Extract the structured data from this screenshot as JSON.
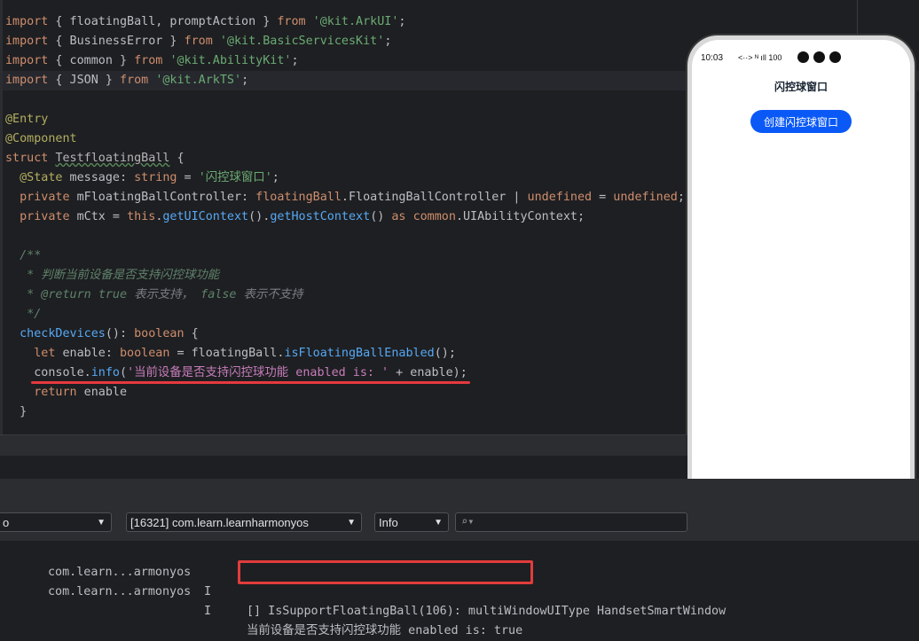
{
  "editor": {
    "lines": [
      [
        {
          "t": "import",
          "c": "kw"
        },
        {
          "t": " { floatingBall, promptAction } "
        },
        {
          "t": "from",
          "c": "kw"
        },
        {
          "t": " "
        },
        {
          "t": "'@kit.ArkUI'",
          "c": "str"
        },
        {
          "t": ";"
        }
      ],
      [
        {
          "t": "import",
          "c": "kw"
        },
        {
          "t": " { BusinessError } "
        },
        {
          "t": "from",
          "c": "kw"
        },
        {
          "t": " "
        },
        {
          "t": "'@kit.BasicServicesKit'",
          "c": "str"
        },
        {
          "t": ";"
        }
      ],
      [
        {
          "t": "import",
          "c": "kw"
        },
        {
          "t": " { common } "
        },
        {
          "t": "from",
          "c": "kw"
        },
        {
          "t": " "
        },
        {
          "t": "'@kit.AbilityKit'",
          "c": "str"
        },
        {
          "t": ";"
        }
      ],
      [
        {
          "t": "import",
          "c": "kw"
        },
        {
          "t": " { JSON } "
        },
        {
          "t": "from",
          "c": "kw"
        },
        {
          "t": " "
        },
        {
          "t": "'@kit.ArkTS'",
          "c": "str"
        },
        {
          "t": ";"
        }
      ],
      [],
      [
        {
          "t": "@Entry",
          "c": "ann"
        }
      ],
      [
        {
          "t": "@Component",
          "c": "ann"
        }
      ],
      [
        {
          "t": "struct",
          "c": "kw"
        },
        {
          "t": " "
        },
        {
          "t": "TestfloatingBall",
          "c": "cls"
        },
        {
          "t": " {"
        }
      ],
      [
        {
          "t": "  "
        },
        {
          "t": "@State",
          "c": "ann"
        },
        {
          "t": " message: "
        },
        {
          "t": "string",
          "c": "kw"
        },
        {
          "t": " = "
        },
        {
          "t": "'闪控球窗口'",
          "c": "str"
        },
        {
          "t": ";"
        }
      ],
      [
        {
          "t": "  "
        },
        {
          "t": "private",
          "c": "kw"
        },
        {
          "t": " mFloatingBallController: "
        },
        {
          "t": "floatingBall",
          "c": "kw"
        },
        {
          "t": ".FloatingBallController | "
        },
        {
          "t": "undefined",
          "c": "kw"
        },
        {
          "t": " = "
        },
        {
          "t": "undefined",
          "c": "kw"
        },
        {
          "t": ";"
        }
      ],
      [
        {
          "t": "  "
        },
        {
          "t": "private",
          "c": "kw"
        },
        {
          "t": " mCtx = "
        },
        {
          "t": "this",
          "c": "kw"
        },
        {
          "t": "."
        },
        {
          "t": "getUIContext",
          "c": "fn"
        },
        {
          "t": "()."
        },
        {
          "t": "getHostContext",
          "c": "fn"
        },
        {
          "t": "() "
        },
        {
          "t": "as",
          "c": "kw"
        },
        {
          "t": " "
        },
        {
          "t": "common",
          "c": "kw"
        },
        {
          "t": ".UIAbilityContext;"
        }
      ],
      [],
      [
        {
          "t": "  /**",
          "c": "cmt"
        }
      ],
      [
        {
          "t": "   * 判断当前设备是否支持闪控球功能",
          "c": "cmt"
        }
      ],
      [
        {
          "t": "   * @return ",
          "c": "cmt"
        },
        {
          "t": "true",
          "c": "cmt"
        },
        {
          "t": " 表示支持， ",
          "c": "cm"
        },
        {
          "t": "false",
          "c": "cmt"
        },
        {
          "t": " 表示不支持",
          "c": "cm"
        }
      ],
      [
        {
          "t": "   */",
          "c": "cmt"
        }
      ],
      [
        {
          "t": "  "
        },
        {
          "t": "checkDevices",
          "c": "fn"
        },
        {
          "t": "(): "
        },
        {
          "t": "boolean",
          "c": "kw"
        },
        {
          "t": " {"
        }
      ],
      [
        {
          "t": "    "
        },
        {
          "t": "let",
          "c": "kw"
        },
        {
          "t": " enable: "
        },
        {
          "t": "boolean",
          "c": "kw"
        },
        {
          "t": " = floatingBall."
        },
        {
          "t": "isFloatingBallEnabled",
          "c": "fn"
        },
        {
          "t": "();"
        }
      ],
      [
        {
          "t": "    console."
        },
        {
          "t": "info",
          "c": "fn"
        },
        {
          "t": "("
        },
        {
          "t": "'当前设备是否支持闪控球功能 enabled is: '",
          "c": "ty"
        },
        {
          "t": " + enable);"
        }
      ],
      [
        {
          "t": "    "
        },
        {
          "t": "return",
          "c": "kw"
        },
        {
          "t": " enable"
        }
      ],
      [
        {
          "t": "  }"
        }
      ]
    ]
  },
  "phone": {
    "time": "10:03",
    "status_icons": "<··>  ᴺ ıll 100",
    "title": "闪控球窗口",
    "button_label": "创建闪控球窗口"
  },
  "logcat": {
    "device_filter": "o",
    "process_filter": "[16321] com.learn.learnharmonyos",
    "level_filter": "Info",
    "search_placeholder": "",
    "rows": [
      {
        "tag": "com.learn...armonyos",
        "level": "I",
        "message": "[] IsSupportFloatingBall(106): multiWindowUIType HandsetSmartWindow"
      },
      {
        "tag": "com.learn...armonyos",
        "level": "I",
        "message": "当前设备是否支持闪控球功能 enabled is: true"
      }
    ]
  },
  "icons": {
    "dropdown": "chevron-down-icon",
    "search": "search-icon"
  },
  "colors": {
    "accent_button": "#0a59f7",
    "highlight_red": "#e5393f"
  }
}
